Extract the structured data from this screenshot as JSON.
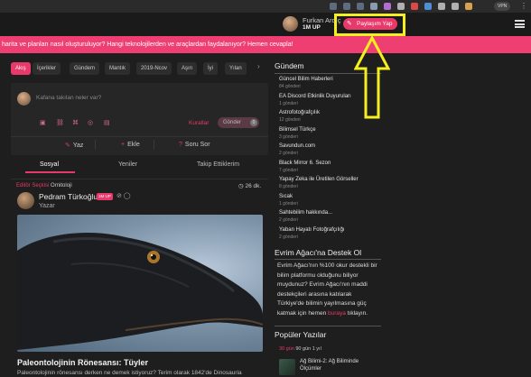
{
  "browser": {
    "vpn_label": "VPN",
    "menu_glyph": "⋮",
    "extension_icons": [
      {
        "name": "cast-icon",
        "color": "#5f6b80"
      },
      {
        "name": "share-icon",
        "color": "#5f6b80"
      },
      {
        "name": "star-icon",
        "color": "#5f6b80"
      },
      {
        "name": "shield-icon",
        "color": "#8a9bb0"
      },
      {
        "name": "mail-icon",
        "color": "#b26bd1"
      },
      {
        "name": "extension-icon-1",
        "color": "#b0b0b0"
      },
      {
        "name": "opera-icon",
        "color": "#e04848"
      },
      {
        "name": "tag-icon",
        "color": "#4d8fd6"
      },
      {
        "name": "puzzle-icon",
        "color": "#b0b0b0"
      },
      {
        "name": "sidebar-icon",
        "color": "#b0b0b0"
      },
      {
        "name": "profile-icon",
        "color": "#d6a24d"
      }
    ]
  },
  "header": {
    "username": "Furkan Ardıç",
    "points": "1M UP",
    "share_button": "Paylaşım Yap",
    "pen_glyph": "✎"
  },
  "banner": {
    "text": "harita ve planları nasıl oluşturuluyor? Hangi teknolojilerden ve araçlardan faydalanıyor? Hemen cevapla!"
  },
  "tags": {
    "items": [
      "Akış",
      "İçerikler",
      "Gündem",
      "Mantık",
      "2019-Ncov",
      "Aşırı",
      "İyi",
      "Yılan"
    ],
    "more_glyph": "›"
  },
  "compose": {
    "placeholder": "Kafana takılan neler var?",
    "rules_label": "Kurallar",
    "send_label": "Gönder",
    "char_count": "0",
    "actions": [
      {
        "glyph": "✎",
        "label": "Yaz"
      },
      {
        "glyph": "+",
        "label": "Ekle"
      },
      {
        "glyph": "?",
        "label": "Soru Sor"
      }
    ]
  },
  "feed_tabs": [
    "Sosyal",
    "Yeniler",
    "Takip Ettiklerim"
  ],
  "post": {
    "category_prefix": "Editör Seçkisi",
    "category": "Ornitoloji",
    "time": "26 dk.",
    "author": "Pedram Türkoğlu",
    "author_badge": "1M UP",
    "role": "Yazar",
    "title": "Paleontolojinin Rönesansı: Tüyler",
    "excerpt": "Paleontolojinin rönesansı derken ne demek istiyoruz? Terim olarak 1842'de Dinosauria",
    "colors": {
      "accent": "#e8396a"
    }
  },
  "sidebar": {
    "gundem_title": "Gündem",
    "gundem": [
      {
        "title": "Güncel Bilim Haberleri",
        "count": "84 gönderi"
      },
      {
        "title": "EA Discord Etkinlik Duyuruları",
        "count": "1 gönderi"
      },
      {
        "title": "Astrofotoğrafçılık",
        "count": "12 gönderi"
      },
      {
        "title": "Bilimsel Türkçe",
        "count": "3 gönderi"
      },
      {
        "title": "Savundun.com",
        "count": "2 gönderi"
      },
      {
        "title": "Black Mirror 6. Sezon",
        "count": "7 gönderi"
      },
      {
        "title": "Yapay Zeka ile Üretilen Görseller",
        "count": "8 gönderi"
      },
      {
        "title": "Sıcak",
        "count": "1 gönderi"
      },
      {
        "title": "Sahtebilim hakkında...",
        "count": "2 gönderi"
      },
      {
        "title": "Yaban Hayatı Fotoğrafçılığı",
        "count": "2 gönderi"
      }
    ],
    "destek_title": "Evrim Ağacı'na Destek Ol",
    "destek_text": "Evrim Ağacı'nın %100 okur destekli bir bilim platformu olduğunu biliyor muydunuz? Evrim Ağacı'nın maddi destekçileri arasına katılarak Türkiye'de bilimin yayılmasına güç katmak için hemen",
    "destek_link": "buraya",
    "destek_end": "tıklayın.",
    "popular_title": "Popüler Yazılar",
    "popular_tabs": [
      "30 gün",
      "90 gün",
      "1 yıl"
    ],
    "popular_item": "Ağ Bilimi-2: Ağ Biliminde Ölçümler"
  }
}
